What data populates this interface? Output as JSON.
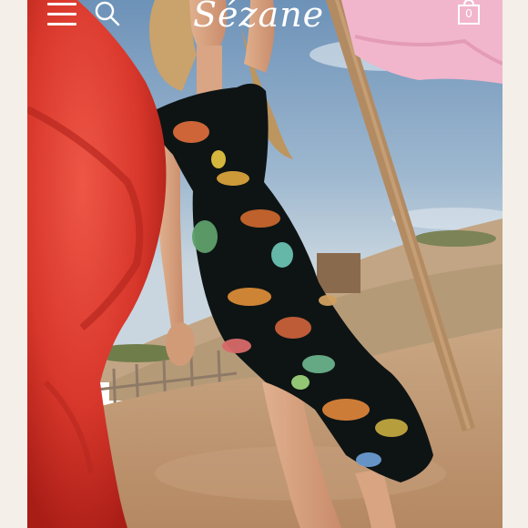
{
  "header": {
    "logo_text": "Sézane",
    "cart_count": "0"
  },
  "icons": {
    "menu": "hamburger-menu-icon",
    "search": "search-icon",
    "cart": "shopping-bag-icon"
  },
  "colors": {
    "header_icons": "#ffffff",
    "scarf_red": "#d8372b",
    "flag_pink": "#f1b6cc",
    "dress": "#0e1414"
  }
}
